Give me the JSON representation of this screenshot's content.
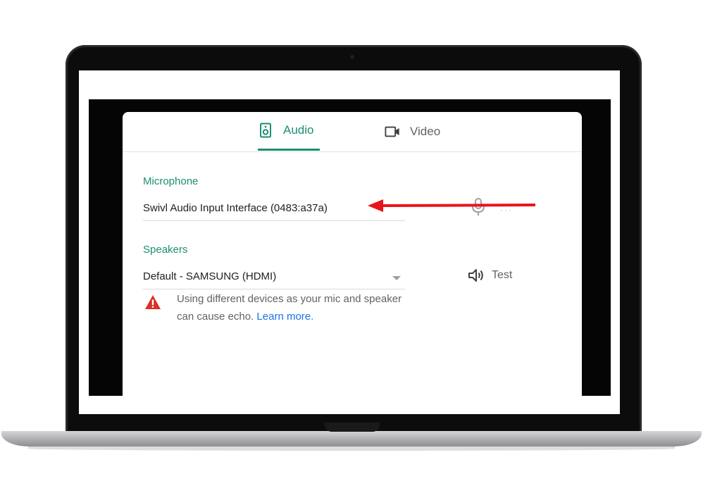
{
  "tabs": [
    {
      "label": "Audio",
      "icon": "speaker-box-icon",
      "active": true
    },
    {
      "label": "Video",
      "icon": "video-camera-icon",
      "active": false
    }
  ],
  "microphone": {
    "label": "Microphone",
    "selected": "Swivl Audio Input Interface (0483:a37a)",
    "level_indicator": "···"
  },
  "speakers": {
    "label": "Speakers",
    "selected": "Default - SAMSUNG (HDMI)",
    "test_label": "Test"
  },
  "warning": {
    "text": "Using different devices as your mic and speaker can cause echo.",
    "link": "Learn more."
  },
  "colors": {
    "accent": "#1e8e72",
    "link": "#1a73e8",
    "warning": "#d93025",
    "annotation_arrow": "#e8141b"
  }
}
